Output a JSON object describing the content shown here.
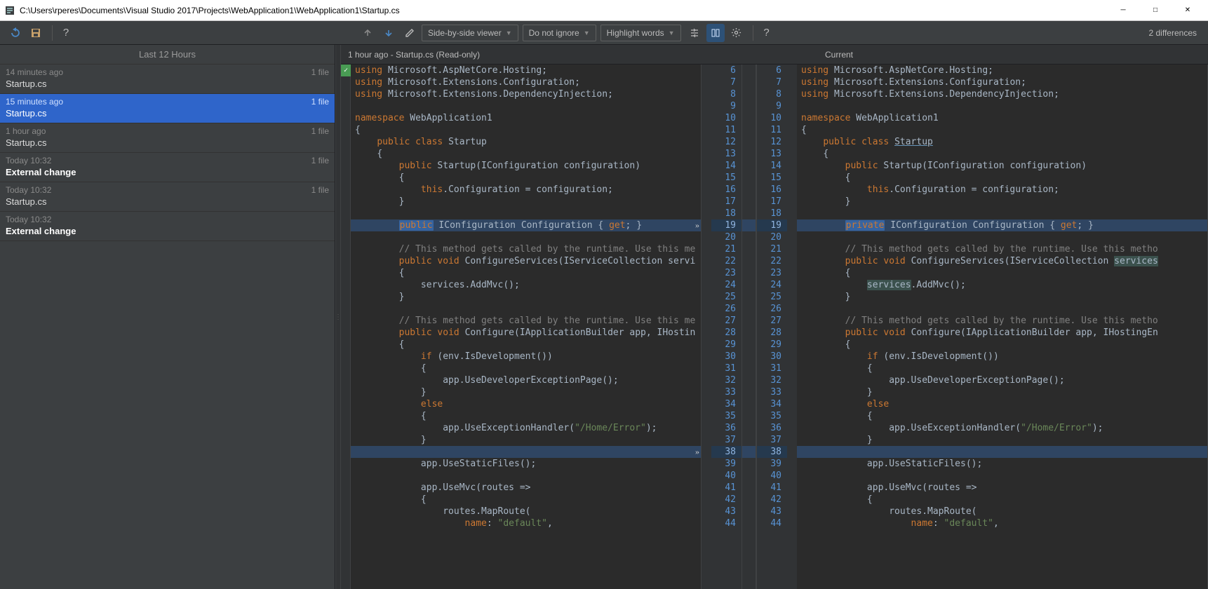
{
  "window": {
    "title": "C:\\Users\\rperes\\Documents\\Visual Studio 2017\\Projects\\WebApplication1\\WebApplication1\\Startup.cs"
  },
  "toolbar": {
    "viewer_mode": "Side-by-side viewer",
    "ignore_mode": "Do not ignore",
    "highlight_mode": "Highlight words",
    "diff_count": "2 differences"
  },
  "sidebar": {
    "header": "Last 12 Hours",
    "items": [
      {
        "time": "14 minutes ago",
        "count": "1 file",
        "title": "Startup.cs",
        "bold": false,
        "selected": false
      },
      {
        "time": "15 minutes ago",
        "count": "1 file",
        "title": "Startup.cs",
        "bold": false,
        "selected": true
      },
      {
        "time": "1 hour ago",
        "count": "1 file",
        "title": "Startup.cs",
        "bold": false,
        "selected": false
      },
      {
        "time": "Today 10:32",
        "count": "1 file",
        "title": "External change",
        "bold": true,
        "selected": false
      },
      {
        "time": "Today 10:32",
        "count": "1 file",
        "title": "Startup.cs",
        "bold": false,
        "selected": false
      },
      {
        "time": "Today 10:32",
        "count": "",
        "title": "External change",
        "bold": true,
        "selected": false
      }
    ]
  },
  "diff": {
    "left_label": "1 hour ago - Startup.cs (Read-only)",
    "right_label": "Current",
    "left_lines": [
      {
        "n": 6,
        "t": "using Microsoft.AspNetCore.Hosting;",
        "cls": ""
      },
      {
        "n": 7,
        "t": "using Microsoft.Extensions.Configuration;",
        "cls": ""
      },
      {
        "n": 8,
        "t": "using Microsoft.Extensions.DependencyInjection;",
        "cls": ""
      },
      {
        "n": 9,
        "t": "",
        "cls": ""
      },
      {
        "n": 10,
        "t": "namespace WebApplication1",
        "cls": ""
      },
      {
        "n": 11,
        "t": "{",
        "cls": ""
      },
      {
        "n": 12,
        "t": "    public class Startup",
        "cls": ""
      },
      {
        "n": 13,
        "t": "    {",
        "cls": ""
      },
      {
        "n": 14,
        "t": "        public Startup(IConfiguration configuration)",
        "cls": ""
      },
      {
        "n": 15,
        "t": "        {",
        "cls": ""
      },
      {
        "n": 16,
        "t": "            this.Configuration = configuration;",
        "cls": ""
      },
      {
        "n": 17,
        "t": "        }",
        "cls": ""
      },
      {
        "n": 18,
        "t": "",
        "cls": ""
      },
      {
        "n": 19,
        "t": "        public IConfiguration Configuration { get; }",
        "cls": "diff-mod",
        "hl": "public"
      },
      {
        "n": 20,
        "t": "",
        "cls": ""
      },
      {
        "n": 21,
        "t": "        // This method gets called by the runtime. Use this me",
        "cls": ""
      },
      {
        "n": 22,
        "t": "        public void ConfigureServices(IServiceCollection servi",
        "cls": ""
      },
      {
        "n": 23,
        "t": "        {",
        "cls": ""
      },
      {
        "n": 24,
        "t": "            services.AddMvc();",
        "cls": ""
      },
      {
        "n": 25,
        "t": "        }",
        "cls": ""
      },
      {
        "n": 26,
        "t": "",
        "cls": ""
      },
      {
        "n": 27,
        "t": "        // This method gets called by the runtime. Use this me",
        "cls": ""
      },
      {
        "n": 28,
        "t": "        public void Configure(IApplicationBuilder app, IHostin",
        "cls": ""
      },
      {
        "n": 29,
        "t": "        {",
        "cls": ""
      },
      {
        "n": 30,
        "t": "            if (env.IsDevelopment())",
        "cls": ""
      },
      {
        "n": 31,
        "t": "            {",
        "cls": ""
      },
      {
        "n": 32,
        "t": "                app.UseDeveloperExceptionPage();",
        "cls": ""
      },
      {
        "n": 33,
        "t": "            }",
        "cls": ""
      },
      {
        "n": 34,
        "t": "            else",
        "cls": ""
      },
      {
        "n": 35,
        "t": "            {",
        "cls": ""
      },
      {
        "n": 36,
        "t": "                app.UseExceptionHandler(\"/Home/Error\");",
        "cls": ""
      },
      {
        "n": 37,
        "t": "            }",
        "cls": ""
      },
      {
        "n": 38,
        "t": "",
        "cls": "diff-mod"
      },
      {
        "n": 39,
        "t": "            app.UseStaticFiles();",
        "cls": ""
      },
      {
        "n": 40,
        "t": "",
        "cls": ""
      },
      {
        "n": 41,
        "t": "            app.UseMvc(routes =>",
        "cls": ""
      },
      {
        "n": 42,
        "t": "            {",
        "cls": ""
      },
      {
        "n": 43,
        "t": "                routes.MapRoute(",
        "cls": ""
      },
      {
        "n": 44,
        "t": "                    name: \"default\",",
        "cls": ""
      }
    ],
    "right_lines": [
      {
        "n": 6,
        "t": "using Microsoft.AspNetCore.Hosting;",
        "cls": ""
      },
      {
        "n": 7,
        "t": "using Microsoft.Extensions.Configuration;",
        "cls": ""
      },
      {
        "n": 8,
        "t": "using Microsoft.Extensions.DependencyInjection;",
        "cls": ""
      },
      {
        "n": 9,
        "t": "",
        "cls": ""
      },
      {
        "n": 10,
        "t": "namespace WebApplication1",
        "cls": ""
      },
      {
        "n": 11,
        "t": "{",
        "cls": ""
      },
      {
        "n": 12,
        "t": "    public class Startup",
        "cls": "",
        "u": "Startup"
      },
      {
        "n": 13,
        "t": "    {",
        "cls": ""
      },
      {
        "n": 14,
        "t": "        public Startup(IConfiguration configuration)",
        "cls": ""
      },
      {
        "n": 15,
        "t": "        {",
        "cls": ""
      },
      {
        "n": 16,
        "t": "            this.Configuration = configuration;",
        "cls": ""
      },
      {
        "n": 17,
        "t": "        }",
        "cls": ""
      },
      {
        "n": 18,
        "t": "",
        "cls": ""
      },
      {
        "n": 19,
        "t": "        private IConfiguration Configuration { get; }",
        "cls": "diff-mod",
        "hl": "private",
        "u": "get;"
      },
      {
        "n": 20,
        "t": "",
        "cls": ""
      },
      {
        "n": 21,
        "t": "        // This method gets called by the runtime. Use this metho",
        "cls": ""
      },
      {
        "n": 22,
        "t": "        public void ConfigureServices(IServiceCollection services",
        "cls": "",
        "bg": "services"
      },
      {
        "n": 23,
        "t": "        {",
        "cls": ""
      },
      {
        "n": 24,
        "t": "            services.AddMvc();",
        "cls": "",
        "bg": "services"
      },
      {
        "n": 25,
        "t": "        }",
        "cls": ""
      },
      {
        "n": 26,
        "t": "",
        "cls": ""
      },
      {
        "n": 27,
        "t": "        // This method gets called by the runtime. Use this metho",
        "cls": ""
      },
      {
        "n": 28,
        "t": "        public void Configure(IApplicationBuilder app, IHostingEn",
        "cls": ""
      },
      {
        "n": 29,
        "t": "        {",
        "cls": ""
      },
      {
        "n": 30,
        "t": "            if (env.IsDevelopment())",
        "cls": ""
      },
      {
        "n": 31,
        "t": "            {",
        "cls": ""
      },
      {
        "n": 32,
        "t": "                app.UseDeveloperExceptionPage();",
        "cls": ""
      },
      {
        "n": 33,
        "t": "            }",
        "cls": ""
      },
      {
        "n": 34,
        "t": "            else",
        "cls": ""
      },
      {
        "n": 35,
        "t": "            {",
        "cls": ""
      },
      {
        "n": 36,
        "t": "                app.UseExceptionHandler(\"/Home/Error\");",
        "cls": ""
      },
      {
        "n": 37,
        "t": "            }",
        "cls": ""
      },
      {
        "n": 38,
        "t": "",
        "cls": "diff-mod"
      },
      {
        "n": 39,
        "t": "            app.UseStaticFiles();",
        "cls": ""
      },
      {
        "n": 40,
        "t": "",
        "cls": ""
      },
      {
        "n": 41,
        "t": "            app.UseMvc(routes =>",
        "cls": ""
      },
      {
        "n": 42,
        "t": "            {",
        "cls": ""
      },
      {
        "n": 43,
        "t": "                routes.MapRoute(",
        "cls": ""
      },
      {
        "n": 44,
        "t": "                    name: \"default\",",
        "cls": ""
      }
    ]
  }
}
